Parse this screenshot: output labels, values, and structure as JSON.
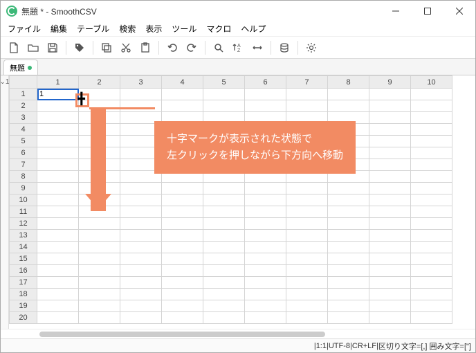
{
  "window": {
    "title": "無題 * - SmoothCSV"
  },
  "menu": {
    "items": [
      "ファイル",
      "編集",
      "テーブル",
      "検索",
      "表示",
      "ツール",
      "マクロ",
      "ヘルプ"
    ]
  },
  "tab": {
    "label": "無題"
  },
  "gutter": {
    "line": "1"
  },
  "grid": {
    "cols": [
      "1",
      "2",
      "3",
      "4",
      "5",
      "6",
      "7",
      "8",
      "9",
      "10"
    ],
    "rows": [
      "1",
      "2",
      "3",
      "4",
      "5",
      "6",
      "7",
      "8",
      "9",
      "10",
      "11",
      "12",
      "13",
      "14",
      "15",
      "16",
      "17",
      "18",
      "19",
      "20"
    ],
    "selected_cell_value": "1"
  },
  "status": {
    "pos": "1:1",
    "enc": "UTF-8",
    "eol": "CR+LF",
    "delim": "区切り文字=[,]",
    "quote": "囲み文字=[\"]"
  },
  "annotation": {
    "text": "十字マークが表示された状態で\n左クリックを押しながら下方向へ移動"
  }
}
